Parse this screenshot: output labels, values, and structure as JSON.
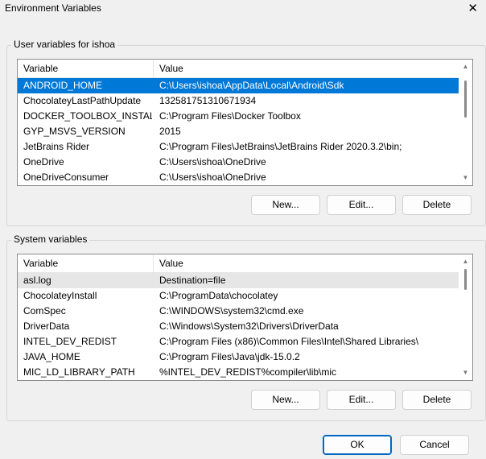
{
  "window": {
    "title": "Environment Variables",
    "close_glyph": "✕"
  },
  "user_vars": {
    "group_label": "User variables for ishoa",
    "columns": [
      "Variable",
      "Value"
    ],
    "rows": [
      {
        "name": "ANDROID_HOME",
        "value": "C:\\Users\\ishoa\\AppData\\Local\\Android\\Sdk"
      },
      {
        "name": "ChocolateyLastPathUpdate",
        "value": "132581751310671934"
      },
      {
        "name": "DOCKER_TOOLBOX_INSTALL...",
        "value": "C:\\Program Files\\Docker Toolbox"
      },
      {
        "name": "GYP_MSVS_VERSION",
        "value": "2015"
      },
      {
        "name": "JetBrains Rider",
        "value": "C:\\Program Files\\JetBrains\\JetBrains Rider 2020.3.2\\bin;"
      },
      {
        "name": "OneDrive",
        "value": "C:\\Users\\ishoa\\OneDrive"
      },
      {
        "name": "OneDriveConsumer",
        "value": "C:\\Users\\ishoa\\OneDrive"
      }
    ],
    "selected_row": 0,
    "buttons": {
      "new": "New...",
      "edit": "Edit...",
      "delete": "Delete"
    }
  },
  "system_vars": {
    "group_label": "System variables",
    "columns": [
      "Variable",
      "Value"
    ],
    "rows": [
      {
        "name": "asl.log",
        "value": "Destination=file"
      },
      {
        "name": "ChocolateyInstall",
        "value": "C:\\ProgramData\\chocolatey"
      },
      {
        "name": "ComSpec",
        "value": "C:\\WINDOWS\\system32\\cmd.exe"
      },
      {
        "name": "DriverData",
        "value": "C:\\Windows\\System32\\Drivers\\DriverData"
      },
      {
        "name": "INTEL_DEV_REDIST",
        "value": "C:\\Program Files (x86)\\Common Files\\Intel\\Shared Libraries\\"
      },
      {
        "name": "JAVA_HOME",
        "value": "C:\\Program Files\\Java\\jdk-15.0.2"
      },
      {
        "name": "MIC_LD_LIBRARY_PATH",
        "value": "%INTEL_DEV_REDIST%compiler\\lib\\mic"
      }
    ],
    "hover_row": 0,
    "buttons": {
      "new": "New...",
      "edit": "Edit...",
      "delete": "Delete"
    }
  },
  "footer": {
    "ok": "OK",
    "cancel": "Cancel"
  },
  "colors": {
    "selection": "#0078d7",
    "hover": "#e6e6e6",
    "background": "#f0f0f0"
  },
  "icons": {
    "scroll_up": "▲",
    "scroll_down": "▼"
  }
}
